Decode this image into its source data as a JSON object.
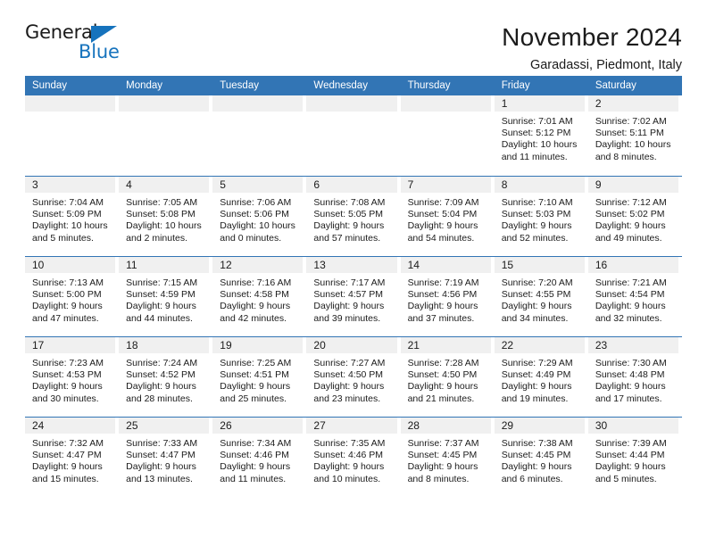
{
  "brand": {
    "name_top": "General",
    "name_bottom": "Blue",
    "triangle_icon": "triangle-icon",
    "accent_color": "#1673bd"
  },
  "header": {
    "title": "November 2024",
    "subtitle": "Garadassi, Piedmont, Italy"
  },
  "colors": {
    "header_blue": "#3275b5",
    "day_band_gray": "#f0f0f0",
    "text": "#1b1b1b"
  },
  "weekdays": [
    "Sunday",
    "Monday",
    "Tuesday",
    "Wednesday",
    "Thursday",
    "Friday",
    "Saturday"
  ],
  "weeks": [
    [
      {
        "day": "",
        "sunrise": "",
        "sunset": "",
        "daylight": "",
        "empty": true
      },
      {
        "day": "",
        "sunrise": "",
        "sunset": "",
        "daylight": "",
        "empty": true
      },
      {
        "day": "",
        "sunrise": "",
        "sunset": "",
        "daylight": "",
        "empty": true
      },
      {
        "day": "",
        "sunrise": "",
        "sunset": "",
        "daylight": "",
        "empty": true
      },
      {
        "day": "",
        "sunrise": "",
        "sunset": "",
        "daylight": "",
        "empty": true
      },
      {
        "day": "1",
        "sunrise": "Sunrise: 7:01 AM",
        "sunset": "Sunset: 5:12 PM",
        "daylight": "Daylight: 10 hours and 11 minutes."
      },
      {
        "day": "2",
        "sunrise": "Sunrise: 7:02 AM",
        "sunset": "Sunset: 5:11 PM",
        "daylight": "Daylight: 10 hours and 8 minutes."
      }
    ],
    [
      {
        "day": "3",
        "sunrise": "Sunrise: 7:04 AM",
        "sunset": "Sunset: 5:09 PM",
        "daylight": "Daylight: 10 hours and 5 minutes."
      },
      {
        "day": "4",
        "sunrise": "Sunrise: 7:05 AM",
        "sunset": "Sunset: 5:08 PM",
        "daylight": "Daylight: 10 hours and 2 minutes."
      },
      {
        "day": "5",
        "sunrise": "Sunrise: 7:06 AM",
        "sunset": "Sunset: 5:06 PM",
        "daylight": "Daylight: 10 hours and 0 minutes."
      },
      {
        "day": "6",
        "sunrise": "Sunrise: 7:08 AM",
        "sunset": "Sunset: 5:05 PM",
        "daylight": "Daylight: 9 hours and 57 minutes."
      },
      {
        "day": "7",
        "sunrise": "Sunrise: 7:09 AM",
        "sunset": "Sunset: 5:04 PM",
        "daylight": "Daylight: 9 hours and 54 minutes."
      },
      {
        "day": "8",
        "sunrise": "Sunrise: 7:10 AM",
        "sunset": "Sunset: 5:03 PM",
        "daylight": "Daylight: 9 hours and 52 minutes."
      },
      {
        "day": "9",
        "sunrise": "Sunrise: 7:12 AM",
        "sunset": "Sunset: 5:02 PM",
        "daylight": "Daylight: 9 hours and 49 minutes."
      }
    ],
    [
      {
        "day": "10",
        "sunrise": "Sunrise: 7:13 AM",
        "sunset": "Sunset: 5:00 PM",
        "daylight": "Daylight: 9 hours and 47 minutes."
      },
      {
        "day": "11",
        "sunrise": "Sunrise: 7:15 AM",
        "sunset": "Sunset: 4:59 PM",
        "daylight": "Daylight: 9 hours and 44 minutes."
      },
      {
        "day": "12",
        "sunrise": "Sunrise: 7:16 AM",
        "sunset": "Sunset: 4:58 PM",
        "daylight": "Daylight: 9 hours and 42 minutes."
      },
      {
        "day": "13",
        "sunrise": "Sunrise: 7:17 AM",
        "sunset": "Sunset: 4:57 PM",
        "daylight": "Daylight: 9 hours and 39 minutes."
      },
      {
        "day": "14",
        "sunrise": "Sunrise: 7:19 AM",
        "sunset": "Sunset: 4:56 PM",
        "daylight": "Daylight: 9 hours and 37 minutes."
      },
      {
        "day": "15",
        "sunrise": "Sunrise: 7:20 AM",
        "sunset": "Sunset: 4:55 PM",
        "daylight": "Daylight: 9 hours and 34 minutes."
      },
      {
        "day": "16",
        "sunrise": "Sunrise: 7:21 AM",
        "sunset": "Sunset: 4:54 PM",
        "daylight": "Daylight: 9 hours and 32 minutes."
      }
    ],
    [
      {
        "day": "17",
        "sunrise": "Sunrise: 7:23 AM",
        "sunset": "Sunset: 4:53 PM",
        "daylight": "Daylight: 9 hours and 30 minutes."
      },
      {
        "day": "18",
        "sunrise": "Sunrise: 7:24 AM",
        "sunset": "Sunset: 4:52 PM",
        "daylight": "Daylight: 9 hours and 28 minutes."
      },
      {
        "day": "19",
        "sunrise": "Sunrise: 7:25 AM",
        "sunset": "Sunset: 4:51 PM",
        "daylight": "Daylight: 9 hours and 25 minutes."
      },
      {
        "day": "20",
        "sunrise": "Sunrise: 7:27 AM",
        "sunset": "Sunset: 4:50 PM",
        "daylight": "Daylight: 9 hours and 23 minutes."
      },
      {
        "day": "21",
        "sunrise": "Sunrise: 7:28 AM",
        "sunset": "Sunset: 4:50 PM",
        "daylight": "Daylight: 9 hours and 21 minutes."
      },
      {
        "day": "22",
        "sunrise": "Sunrise: 7:29 AM",
        "sunset": "Sunset: 4:49 PM",
        "daylight": "Daylight: 9 hours and 19 minutes."
      },
      {
        "day": "23",
        "sunrise": "Sunrise: 7:30 AM",
        "sunset": "Sunset: 4:48 PM",
        "daylight": "Daylight: 9 hours and 17 minutes."
      }
    ],
    [
      {
        "day": "24",
        "sunrise": "Sunrise: 7:32 AM",
        "sunset": "Sunset: 4:47 PM",
        "daylight": "Daylight: 9 hours and 15 minutes."
      },
      {
        "day": "25",
        "sunrise": "Sunrise: 7:33 AM",
        "sunset": "Sunset: 4:47 PM",
        "daylight": "Daylight: 9 hours and 13 minutes."
      },
      {
        "day": "26",
        "sunrise": "Sunrise: 7:34 AM",
        "sunset": "Sunset: 4:46 PM",
        "daylight": "Daylight: 9 hours and 11 minutes."
      },
      {
        "day": "27",
        "sunrise": "Sunrise: 7:35 AM",
        "sunset": "Sunset: 4:46 PM",
        "daylight": "Daylight: 9 hours and 10 minutes."
      },
      {
        "day": "28",
        "sunrise": "Sunrise: 7:37 AM",
        "sunset": "Sunset: 4:45 PM",
        "daylight": "Daylight: 9 hours and 8 minutes."
      },
      {
        "day": "29",
        "sunrise": "Sunrise: 7:38 AM",
        "sunset": "Sunset: 4:45 PM",
        "daylight": "Daylight: 9 hours and 6 minutes."
      },
      {
        "day": "30",
        "sunrise": "Sunrise: 7:39 AM",
        "sunset": "Sunset: 4:44 PM",
        "daylight": "Daylight: 9 hours and 5 minutes."
      }
    ]
  ]
}
